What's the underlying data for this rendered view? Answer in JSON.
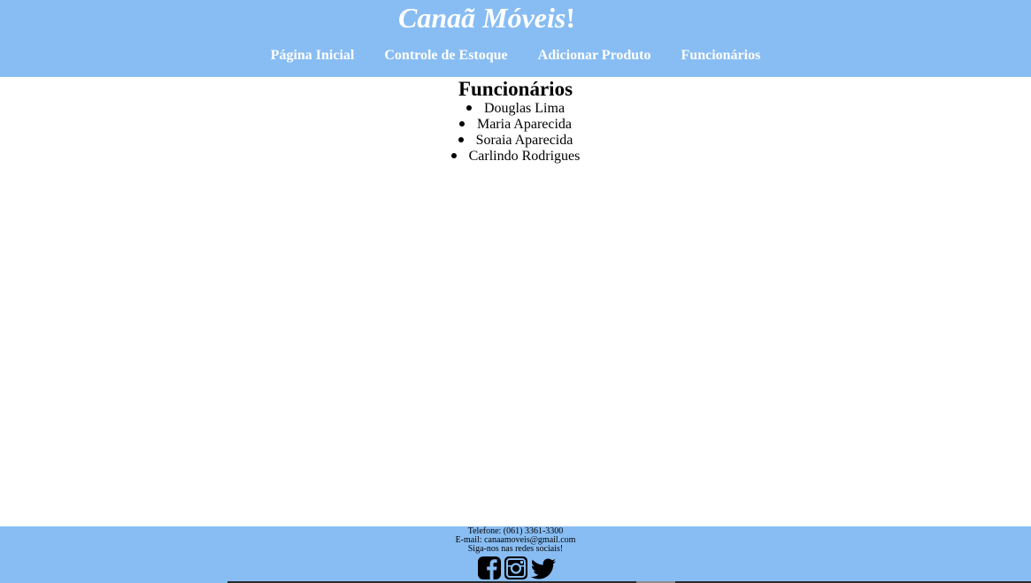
{
  "header": {
    "brand_name": "Canaã Móveis",
    "brand_suffix": "!",
    "colors": {
      "background": "#88bdf3",
      "text": "#ffffff"
    }
  },
  "nav": {
    "items": [
      {
        "label": "Página Inicial"
      },
      {
        "label": "Controle de Estoque"
      },
      {
        "label": "Adicionar Produto"
      },
      {
        "label": "Funcionários"
      }
    ]
  },
  "main": {
    "title": "Funcionários",
    "employees": [
      "Douglas Lima",
      "Maria Aparecida",
      "Soraia Aparecida",
      "Carlindo Rodrigues"
    ]
  },
  "footer": {
    "phone": "Telefone: (061) 3361-3300",
    "email": "E-mail: canaamoveis@gmail.com",
    "follow_text": "Siga-nos nas redes sociais!",
    "social_icons": [
      "facebook-icon",
      "instagram-icon",
      "twitter-icon"
    ],
    "colors": {
      "background": "#88bdf3"
    }
  }
}
